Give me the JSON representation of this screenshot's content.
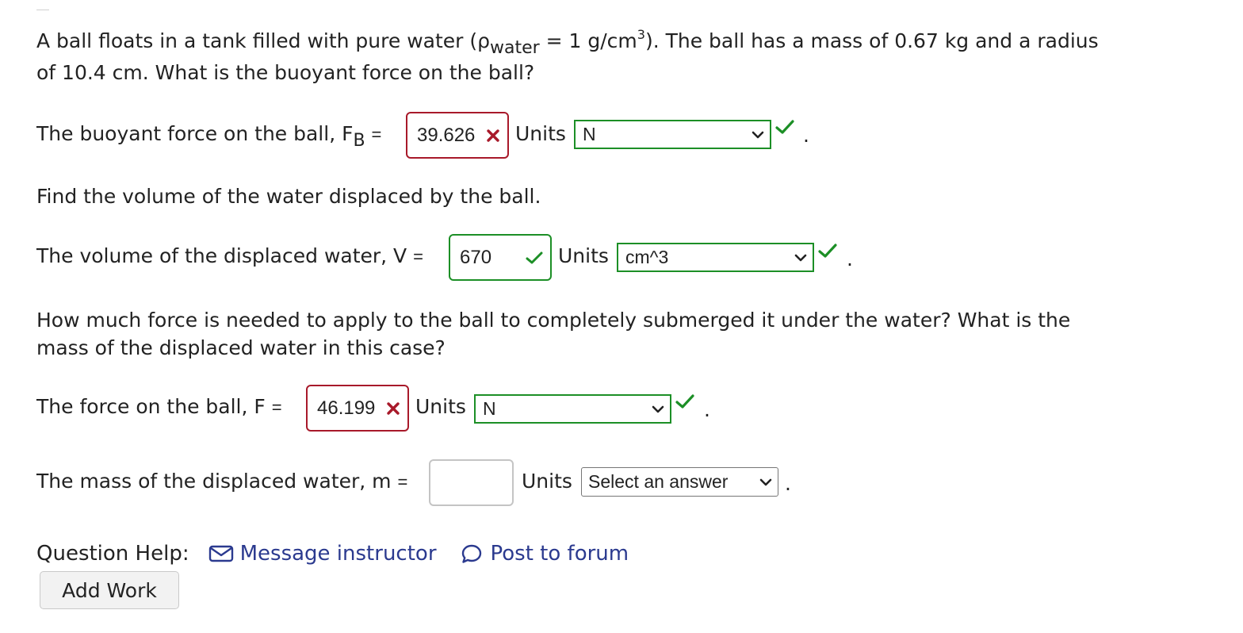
{
  "question": {
    "line1_a": "A ball floats in a tank filled with pure water (ρ",
    "line1_sub": "water",
    "line1_b": " = 1 g/cm",
    "line1_sup": "3",
    "line1_c": "). The ball has a mass of 0.67 kg and a radius",
    "line2": "of 10.4 cm. What is the buoyant force on the ball?"
  },
  "part1": {
    "label_a": "The buoyant force on the ball, F",
    "label_sub": "B",
    "eq": "=",
    "value": "39.626",
    "status": "incorrect",
    "units_label": "Units",
    "units_selected": "N",
    "units_status": "correct",
    "period": "."
  },
  "prompt2": "Find the volume of the water displaced by the ball.",
  "part2": {
    "label": "The volume of the displaced water, V",
    "eq": "=",
    "value": "670",
    "status": "correct",
    "units_label": "Units",
    "units_selected": "cm^3",
    "units_status": "correct",
    "period": "."
  },
  "prompt3": {
    "line1": "How much force is needed to apply to the ball to completely submerged it under the water? What is the",
    "line2": "mass of the displaced water in this case?"
  },
  "part3": {
    "label": "The force on the ball, F",
    "eq": "=",
    "value": "46.199",
    "status": "incorrect",
    "units_label": "Units",
    "units_selected": "N",
    "units_status": "correct",
    "period": "."
  },
  "part4": {
    "label": "The mass of the displaced water, m",
    "eq": "=",
    "value": "",
    "units_label": "Units",
    "units_selected": "Select an answer",
    "period": "."
  },
  "help": {
    "label": "Question Help:",
    "message_link": "Message instructor",
    "forum_link": "Post to forum",
    "message_icon": "envelope-icon",
    "forum_icon": "speech-bubble-icon"
  },
  "add_work_button": "Add Work",
  "colors": {
    "correct": "#1c8f26",
    "incorrect": "#a8192a",
    "link": "#2b3a8f"
  }
}
